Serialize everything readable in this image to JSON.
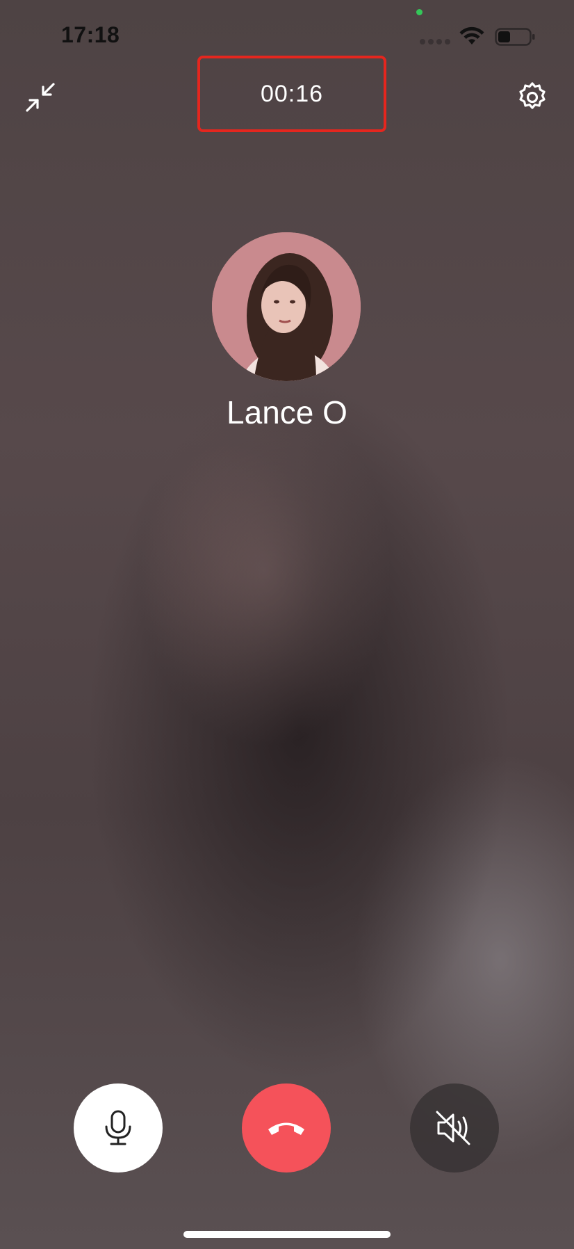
{
  "status_bar": {
    "time": "17:18",
    "icons": [
      "camera-indicator",
      "signal-dots",
      "wifi-icon",
      "battery-icon"
    ],
    "battery_level": 0.35
  },
  "call": {
    "timer": "00:16",
    "caller_name": "Lance O",
    "highlight_color": "#e5261e"
  },
  "top_actions": {
    "minimize_icon": "minimize-arrows-icon",
    "settings_icon": "gear-icon"
  },
  "controls": {
    "mic_icon": "microphone-icon",
    "hangup_icon": "phone-hangup-icon",
    "speaker_icon": "speaker-muted-icon",
    "hangup_color": "#f5525a"
  }
}
